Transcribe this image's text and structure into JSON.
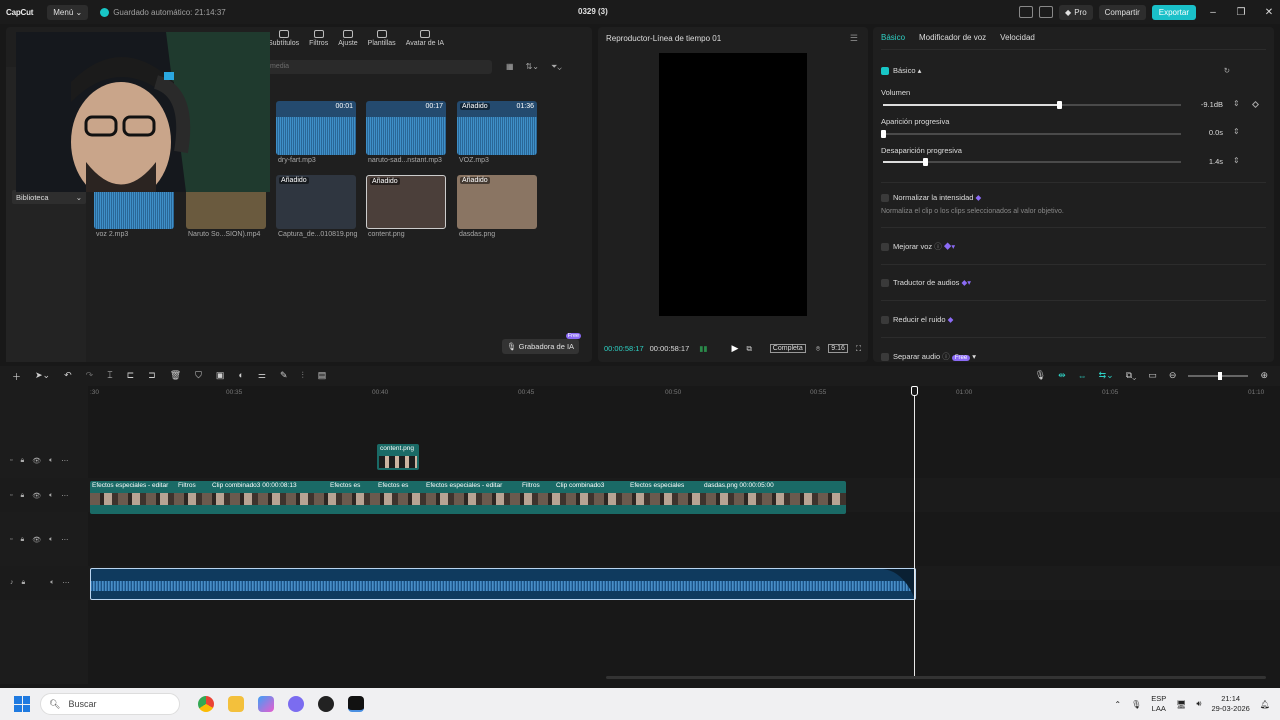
{
  "titlebar": {
    "logo": "CapCut",
    "menu": "Menú",
    "autosave": "Guardado automático: 21:14:37",
    "project": "0329 (3)",
    "pro": "Pro",
    "share": "Compartir",
    "export": "Exportar"
  },
  "media": {
    "tabs": [
      "Subtítulos",
      "Filtros",
      "Ajuste",
      "Plantillas",
      "Avatar de IA"
    ],
    "search_placeholder": "media",
    "library": "Biblioteca",
    "recorder": "Grabadora de IA",
    "recorder_badge": "Free",
    "items": [
      {
        "name": "dry-fart.mp3",
        "duration": "00:01",
        "badge": ""
      },
      {
        "name": "naruto-sad...nstant.mp3",
        "duration": "00:17",
        "badge": ""
      },
      {
        "name": "VOZ.mp3",
        "duration": "01:36",
        "badge": "Añadido"
      },
      {
        "name": "voz 2.mp3",
        "duration": "",
        "badge": ""
      },
      {
        "name": "Naruto So...SION).mp4",
        "duration": "",
        "badge": ""
      },
      {
        "name": "Captura_de...010819.png",
        "duration": "",
        "badge": "Añadido"
      },
      {
        "name": "content.png",
        "duration": "",
        "badge": "Añadido"
      },
      {
        "name": "dasdas.png",
        "duration": "",
        "badge": "Añadido"
      }
    ]
  },
  "player": {
    "title": "Reproductor-Línea de tiempo 01",
    "current": "00:00:58:17",
    "total": "00:00:58:17",
    "full": "Completa",
    "ratio": "9:16"
  },
  "props": {
    "tabs": [
      "Básico",
      "Modificador de voz",
      "Velocidad"
    ],
    "section": "Básico",
    "volume_label": "Volumen",
    "volume_value": "-9.1dB",
    "volume_level": 0.59,
    "fade_in_label": "Aparición progresiva",
    "fade_in_value": "0.0s",
    "fade_in_level": 0,
    "fade_out_label": "Desaparición progresiva",
    "fade_out_value": "1.4s",
    "fade_out_level": 0.14,
    "normalize_label": "Normalizar la intensidad",
    "normalize_sub": "Normaliza el clip o los clips seleccionados al valor objetivo.",
    "enhance_label": "Mejorar voz",
    "translate_label": "Traductor de audios",
    "noise_label": "Reducir el ruido",
    "separate_label": "Separar audio",
    "free": "Free"
  },
  "timeline": {
    "ruler": [
      ":30",
      "00:35",
      "00:40",
      "00:45",
      "00:50",
      "00:55",
      "01:00",
      "01:05",
      "01:10"
    ],
    "content_clip": "content.png",
    "clip_labels": [
      "Efectos especiales - editar",
      "Filtros",
      "Clip combinado3  00:00:08:13",
      "Efectos es",
      "Efectos es",
      "Efectos especiales - editar",
      "Filtros",
      "Clip combinado3",
      "Efectos especiales",
      "dasdas.png  00:00:05:00"
    ]
  },
  "taskbar": {
    "search": "Buscar",
    "lang_top": "ESP",
    "lang_bottom": "LAA",
    "time": "21:14",
    "date": "29-03-2026"
  }
}
